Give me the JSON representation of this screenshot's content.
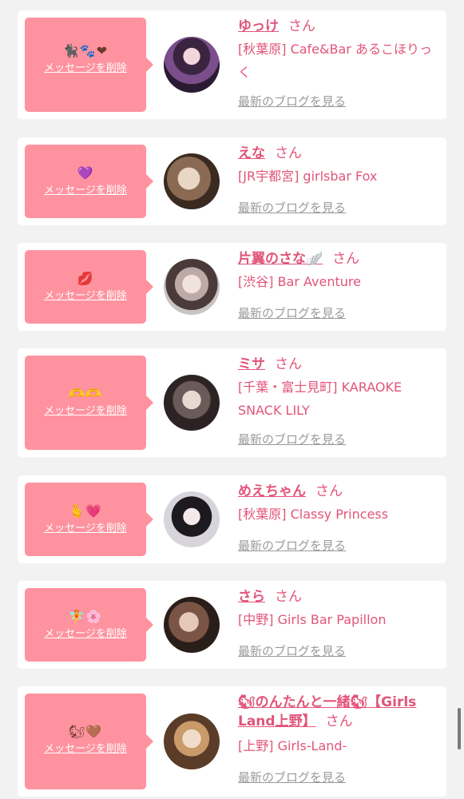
{
  "delete_label": "メッセージを削除",
  "blog_label": "最新のブログを見る",
  "honorific": "さん",
  "colors": {
    "bubble": "#ff929f",
    "accent": "#e2547a",
    "muted": "#9a9a9a",
    "background": "#f2f2f2"
  },
  "messages": [
    {
      "emoji": "🐈‍⬛🐾❤",
      "name": "ゆっけ",
      "shop": "[秋葉原] Cafe&Bar あるこほりっく",
      "avatar_icon": "avatar-photo-icon"
    },
    {
      "emoji": "💜",
      "name": "えな",
      "shop": "[JR宇都宮] girlsbar Fox",
      "avatar_icon": "avatar-photo-icon"
    },
    {
      "emoji": "💋",
      "name": "片翼のさな🪽",
      "shop": "[渋谷] Bar Aventure",
      "avatar_icon": "avatar-photo-icon"
    },
    {
      "emoji": "🫶🫶",
      "name": "ミサ",
      "shop": "[千葉・富士見町] KARAOKE SNACK LILY",
      "avatar_icon": "avatar-photo-icon"
    },
    {
      "emoji": "🫰💗",
      "name": "めえちゃん",
      "shop": "[秋葉原] Classy Princess",
      "avatar_icon": "avatar-photo-icon"
    },
    {
      "emoji": "🧚🌸",
      "name": "さら",
      "shop": "[中野] Girls Bar Papillon",
      "avatar_icon": "avatar-photo-icon"
    },
    {
      "emoji": "🐿🤎",
      "name": "🐿のんたんと一緒🐿【Girls Land上野】",
      "shop": "[上野] Girls-Land-",
      "avatar_icon": "avatar-photo-icon"
    }
  ]
}
